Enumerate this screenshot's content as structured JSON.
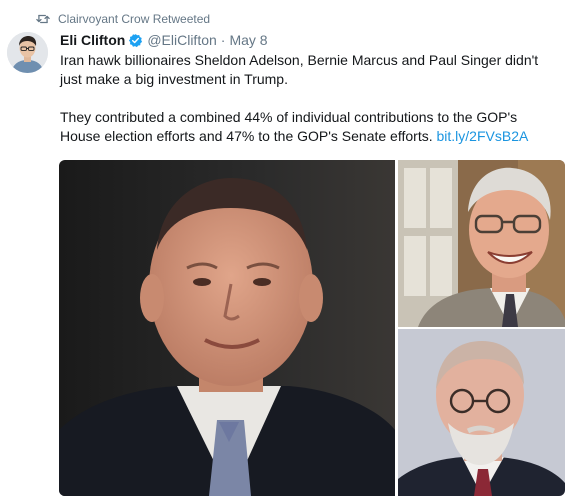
{
  "retweet": {
    "text": "Clairvoyant Crow Retweeted",
    "icon": "retweet-icon"
  },
  "tweet": {
    "author_name": "Eli Clifton",
    "handle": "@EliClifton",
    "separator": "·",
    "time": "May 8",
    "verified_icon": "verified-badge-icon",
    "paragraph1": "Iran hawk billionaires Sheldon Adelson, Bernie Marcus and Paul Singer didn't just make a big investment in Trump.",
    "paragraph2": "They contributed a combined 44% of individual contributions to the GOP's House election efforts and 47% to the GOP's Senate efforts.",
    "link": "bit.ly/2FVsB2A"
  },
  "colors": {
    "link": "#1b95e0",
    "secondary": "#657786",
    "text": "#14171a",
    "verified": "#1da1f2"
  }
}
